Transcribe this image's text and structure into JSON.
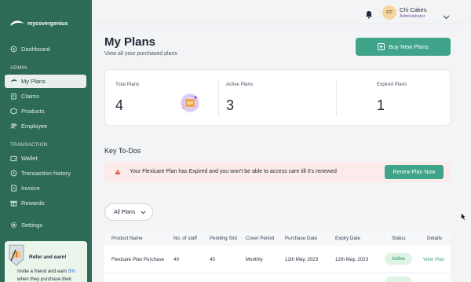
{
  "brand": {
    "name": "mycovergenius"
  },
  "sidebar": {
    "dashboard": "Dashboard",
    "admin_label": "ADMIN",
    "admin_items": [
      "My Plans",
      "Claims",
      "Products",
      "Employee"
    ],
    "transaction_label": "TRANSACTION",
    "transaction_items": [
      "Wallet",
      "Transaction history",
      "Invoice",
      "Rewards"
    ],
    "settings": "Settings",
    "active_item": "My Plans"
  },
  "refer": {
    "title": "Refer and earn!",
    "text_prefix": "Invite a friend and earn ",
    "highlight": "5%",
    "text_suffix": " when they purchase their"
  },
  "user": {
    "initials": "CC",
    "name": "Chi Cakes",
    "role": "Administrator"
  },
  "page": {
    "title": "My Plans",
    "subtitle": "View all your purchased plans",
    "buy_button": "Buy New Plans"
  },
  "stats": {
    "total": {
      "label": "Total Plans",
      "value": "4"
    },
    "active": {
      "label": "Active Plans",
      "value": "3"
    },
    "expired": {
      "label": "Expired Plans",
      "value": "1"
    }
  },
  "todos": {
    "title": "Key To-Dos",
    "message": "Your Flexicare Plan has Expired and you won't be able to access care till it's renewed",
    "action": "Renew Plan Now"
  },
  "filter": {
    "selected": "All Plans"
  },
  "table": {
    "headers": [
      "Product Name",
      "No. of staff",
      "Pending Slot",
      "Cover Period",
      "Purchase Date",
      "Expiry Date",
      "Status",
      "Details"
    ],
    "rows": [
      {
        "product": "Flexicare Plan Purchase",
        "staff": "40",
        "pending": "40",
        "period": "Monthly",
        "purchase": "12th May, 2023",
        "expiry": "12th May, 2023",
        "status": "Active",
        "details": "View Plan"
      }
    ]
  },
  "colors": {
    "sidebar": "#2e6b57",
    "accent": "#3fa489",
    "alert_bg": "#fdeaea"
  }
}
